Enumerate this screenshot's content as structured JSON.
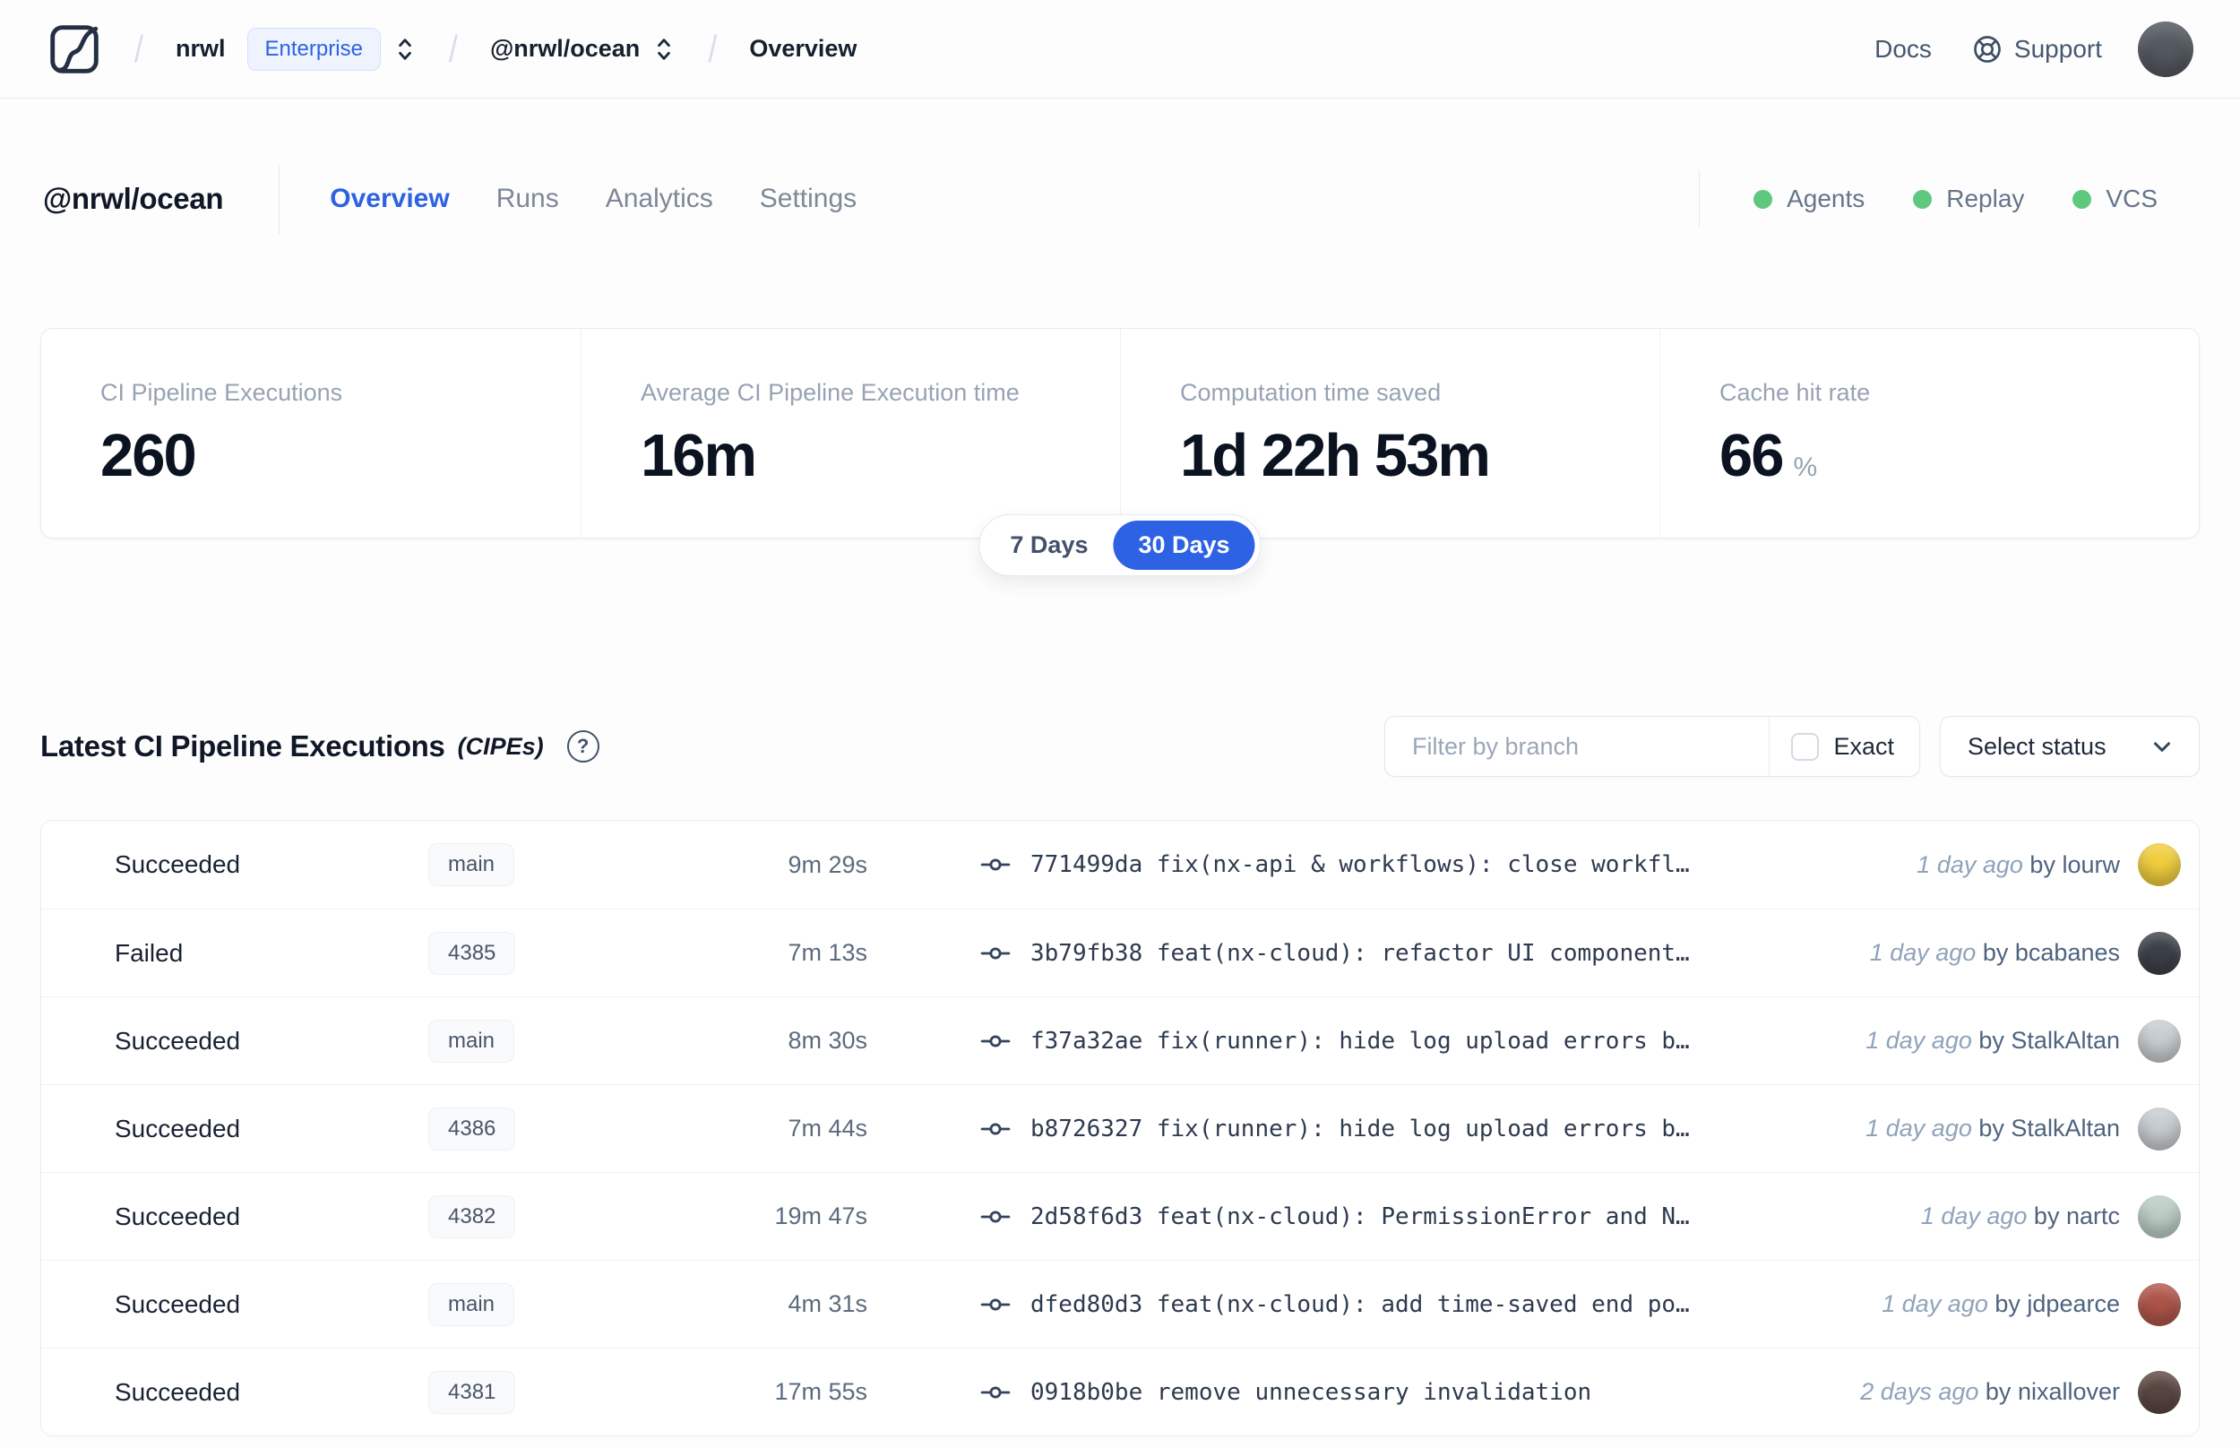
{
  "navbar": {
    "breadcrumb": {
      "org": "nrwl",
      "org_badge": "Enterprise",
      "workspace": "@nrwl/ocean",
      "page": "Overview"
    },
    "links": {
      "docs": "Docs",
      "support": "Support"
    },
    "avatar_color": "#565b62"
  },
  "header": {
    "title": "@nrwl/ocean",
    "tabs": [
      {
        "label": "Overview",
        "active": true
      },
      {
        "label": "Runs",
        "active": false
      },
      {
        "label": "Analytics",
        "active": false
      },
      {
        "label": "Settings",
        "active": false
      }
    ],
    "statuses": [
      {
        "label": "Agents",
        "color": "#5ec87e"
      },
      {
        "label": "Replay",
        "color": "#5ec87e"
      },
      {
        "label": "VCS",
        "color": "#5ec87e"
      }
    ]
  },
  "stats": {
    "cards": [
      {
        "label": "CI Pipeline Executions",
        "value": "260",
        "suffix": ""
      },
      {
        "label": "Average CI Pipeline Execution time",
        "value": "16m",
        "suffix": ""
      },
      {
        "label": "Computation time saved",
        "value": "1d 22h 53m",
        "suffix": ""
      },
      {
        "label": "Cache hit rate",
        "value": "66",
        "suffix": "%"
      }
    ],
    "range_toggle": {
      "options": [
        "7 Days",
        "30 Days"
      ],
      "selected": "30 Days"
    }
  },
  "cipe_section": {
    "title": "Latest CI Pipeline Executions",
    "title_suffix": "(CIPEs)",
    "help_glyph": "?",
    "filter_placeholder": "Filter by branch",
    "exact_label": "Exact",
    "exact_checked": false,
    "status_select_label": "Select status",
    "by_label": "by",
    "rows": [
      {
        "status": "Succeeded",
        "status_color": "#12b76a",
        "branch": "main",
        "duration": "9m 29s",
        "commit": "771499da fix(nx-api & workflows): close workfl…",
        "time_ago": "1 day ago",
        "author": "lourw",
        "avatar_color": "#f2cf3e"
      },
      {
        "status": "Failed",
        "status_color": "#f04438",
        "branch": "4385",
        "duration": "7m 13s",
        "commit": "3b79fb38 feat(nx-cloud): refactor UI component…",
        "time_ago": "1 day ago",
        "author": "bcabanes",
        "avatar_color": "#3c4148"
      },
      {
        "status": "Succeeded",
        "status_color": "#12b76a",
        "branch": "main",
        "duration": "8m 30s",
        "commit": "f37a32ae fix(runner): hide log upload errors b…",
        "time_ago": "1 day ago",
        "author": "StalkAltan",
        "avatar_color": "#c9ced2"
      },
      {
        "status": "Succeeded",
        "status_color": "#12b76a",
        "branch": "4386",
        "duration": "7m 44s",
        "commit": "b8726327 fix(runner): hide log upload errors b…",
        "time_ago": "1 day ago",
        "author": "StalkAltan",
        "avatar_color": "#c9ced2"
      },
      {
        "status": "Succeeded",
        "status_color": "#12b76a",
        "branch": "4382",
        "duration": "19m 47s",
        "commit": "2d58f6d3 feat(nx-cloud): PermissionError and N…",
        "time_ago": "1 day ago",
        "author": "nartc",
        "avatar_color": "#bccfc6"
      },
      {
        "status": "Succeeded",
        "status_color": "#12b76a",
        "branch": "main",
        "duration": "4m 31s",
        "commit": "dfed80d3 feat(nx-cloud): add time-saved end po…",
        "time_ago": "1 day ago",
        "author": "jdpearce",
        "avatar_color": "#b0564a"
      },
      {
        "status": "Succeeded",
        "status_color": "#12b76a",
        "branch": "4381",
        "duration": "17m 55s",
        "commit": "0918b0be remove unnecessary invalidation",
        "time_ago": "2 days ago",
        "author": "nixallover",
        "avatar_color": "#5a4742"
      }
    ]
  },
  "colors": {
    "accent_blue": "#2e62e4",
    "success_green": "#12b76a",
    "error_red": "#f04438"
  }
}
